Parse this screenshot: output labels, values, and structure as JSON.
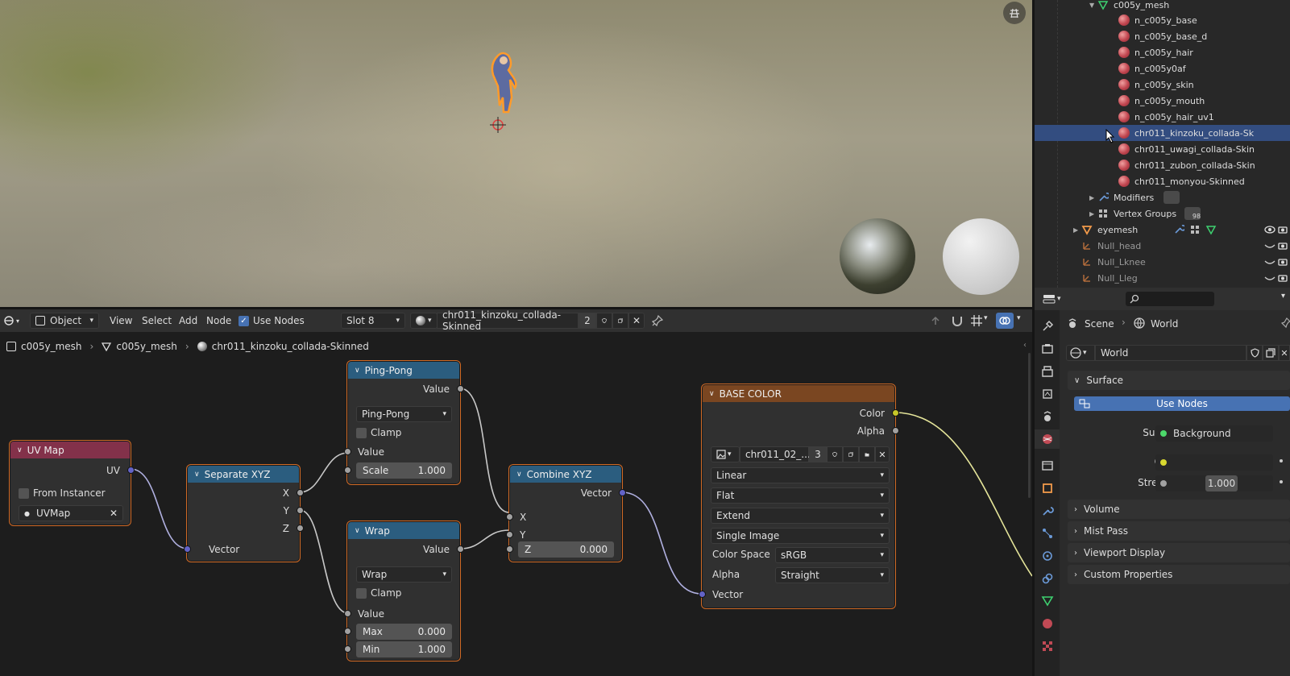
{
  "outliner": {
    "rows": [
      {
        "label": "c005y_mesh",
        "type": "mesh"
      },
      {
        "label": "n_c005y_base",
        "type": "material"
      },
      {
        "label": "n_c005y_base_d",
        "type": "material"
      },
      {
        "label": "n_c005y_hair",
        "type": "material"
      },
      {
        "label": "n_c005y0af",
        "type": "material"
      },
      {
        "label": "n_c005y_skin",
        "type": "material"
      },
      {
        "label": "n_c005y_mouth",
        "type": "material"
      },
      {
        "label": "n_c005y_hair_uv1",
        "type": "material"
      },
      {
        "label": "chr011_kinzoku_collada-Sk",
        "type": "material",
        "selected": true
      },
      {
        "label": "chr011_uwagi_collada-Skin",
        "type": "material"
      },
      {
        "label": "chr011_zubon_collada-Skin",
        "type": "material"
      },
      {
        "label": "chr011_monyou-Skinned",
        "type": "material"
      },
      {
        "label": "Modifiers",
        "type": "modifiers"
      },
      {
        "label": "Vertex Groups",
        "type": "vgroups",
        "badge": "98"
      },
      {
        "label": "eyemesh",
        "type": "object"
      },
      {
        "label": "Null_head",
        "type": "empty"
      },
      {
        "label": "Null_Lknee",
        "type": "empty"
      },
      {
        "label": "Null_Lleg",
        "type": "empty"
      }
    ]
  },
  "node_header": {
    "mode": "Object",
    "menus": [
      "View",
      "Select",
      "Add",
      "Node"
    ],
    "use_nodes_label": "Use Nodes",
    "slot": "Slot 8",
    "material_name": "chr011_kinzoku_collada-Skinned",
    "users": "2"
  },
  "breadcrumbs": [
    "c005y_mesh",
    "c005y_mesh",
    "chr011_kinzoku_collada-Skinned"
  ],
  "nodes": {
    "uvmap": {
      "title": "UV Map",
      "out": "UV",
      "from_instancer": "From Instancer",
      "uv_value": "UVMap"
    },
    "sepxyz": {
      "title": "Separate XYZ",
      "x": "X",
      "y": "Y",
      "z": "Z",
      "in": "Vector"
    },
    "pingpong": {
      "title": "Ping-Pong",
      "out": "Value",
      "op": "Ping-Pong",
      "clamp": "Clamp",
      "in": "Value",
      "scale_label": "Scale",
      "scale_value": "1.000"
    },
    "wrap": {
      "title": "Wrap",
      "out": "Value",
      "op": "Wrap",
      "clamp": "Clamp",
      "in": "Value",
      "max_label": "Max",
      "max_value": "0.000",
      "min_label": "Min",
      "min_value": "1.000"
    },
    "combxyz": {
      "title": "Combine XYZ",
      "out": "Vector",
      "x": "X",
      "y": "Y",
      "z_label": "Z",
      "z_value": "0.000"
    },
    "basecolor": {
      "title": "BASE COLOR",
      "color": "Color",
      "alpha": "Alpha",
      "image": "chr011_02_...",
      "users": "3",
      "interp": "Linear",
      "proj": "Flat",
      "ext": "Extend",
      "source": "Single Image",
      "cs_label": "Color Space",
      "cs_value": "sRGB",
      "alpha_label": "Alpha",
      "alpha_value": "Straight",
      "vector": "Vector"
    }
  },
  "props": {
    "scene": "Scene",
    "world": "World",
    "world_block": "World",
    "surface_panel": "Surface",
    "use_nodes": "Use Nodes",
    "surface_label": "Surface",
    "surface_value": "Background",
    "color_label": "Color",
    "strength_label": "Strength",
    "strength_value": "1.000",
    "panels": [
      "Volume",
      "Mist Pass",
      "Viewport Display",
      "Custom Properties"
    ]
  },
  "colors": {
    "accent": "#4772b3",
    "selected_row": "#334d80",
    "node_border": "#d06a26"
  }
}
